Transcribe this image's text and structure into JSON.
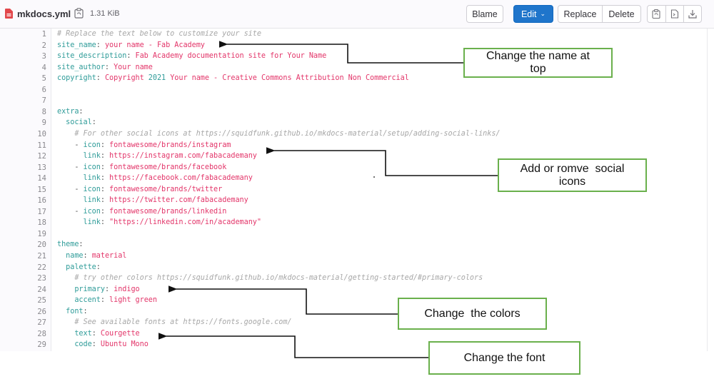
{
  "header": {
    "file_name": "mkdocs.yml",
    "file_size": "1.31 KiB",
    "buttons": {
      "blame": "Blame",
      "edit": "Edit",
      "replace": "Replace",
      "delete": "Delete"
    },
    "icons": [
      "file-icon",
      "copy-path-icon",
      "copy-contents-icon",
      "open-raw-icon",
      "download-icon"
    ]
  },
  "code": {
    "lines": [
      {
        "n": "1",
        "parts": [
          {
            "t": "c",
            "s": "# Replace the text below to customize your site"
          }
        ]
      },
      {
        "n": "2",
        "parts": [
          {
            "t": "k",
            "s": "site_name"
          },
          {
            "t": "p",
            "s": ": "
          },
          {
            "t": "v",
            "s": "your name - Fab Academy"
          }
        ]
      },
      {
        "n": "3",
        "parts": [
          {
            "t": "k",
            "s": "site_description"
          },
          {
            "t": "p",
            "s": ": "
          },
          {
            "t": "v",
            "s": "Fab Academy documentation site for Your Name"
          }
        ]
      },
      {
        "n": "4",
        "parts": [
          {
            "t": "k",
            "s": "site_author"
          },
          {
            "t": "p",
            "s": ": "
          },
          {
            "t": "v",
            "s": "Your name"
          }
        ]
      },
      {
        "n": "5",
        "parts": [
          {
            "t": "k",
            "s": "copyright"
          },
          {
            "t": "p",
            "s": ": "
          },
          {
            "t": "v",
            "s": "Copyright "
          },
          {
            "t": "k",
            "s": "2021"
          },
          {
            "t": "v",
            "s": " Your name - Creative Commons Attribution Non Commercial"
          }
        ]
      },
      {
        "n": "6",
        "parts": []
      },
      {
        "n": "7",
        "parts": []
      },
      {
        "n": "8",
        "parts": [
          {
            "t": "k",
            "s": "extra"
          },
          {
            "t": "p",
            "s": ":"
          }
        ]
      },
      {
        "n": "9",
        "parts": [
          {
            "t": "p",
            "s": "  "
          },
          {
            "t": "k",
            "s": "social"
          },
          {
            "t": "p",
            "s": ":"
          }
        ]
      },
      {
        "n": "10",
        "parts": [
          {
            "t": "c",
            "s": "    # For other social icons at https://squidfunk.github.io/mkdocs-material/setup/adding-social-links/"
          }
        ]
      },
      {
        "n": "11",
        "parts": [
          {
            "t": "p",
            "s": "    - "
          },
          {
            "t": "k",
            "s": "icon"
          },
          {
            "t": "p",
            "s": ": "
          },
          {
            "t": "v",
            "s": "fontawesome/brands/instagram"
          }
        ]
      },
      {
        "n": "12",
        "parts": [
          {
            "t": "p",
            "s": "      "
          },
          {
            "t": "k",
            "s": "link"
          },
          {
            "t": "p",
            "s": ": "
          },
          {
            "t": "v",
            "s": "https://instagram.com/fabacademany"
          }
        ]
      },
      {
        "n": "13",
        "parts": [
          {
            "t": "p",
            "s": "    - "
          },
          {
            "t": "k",
            "s": "icon"
          },
          {
            "t": "p",
            "s": ": "
          },
          {
            "t": "v",
            "s": "fontawesome/brands/facebook"
          }
        ]
      },
      {
        "n": "14",
        "parts": [
          {
            "t": "p",
            "s": "      "
          },
          {
            "t": "k",
            "s": "link"
          },
          {
            "t": "p",
            "s": ": "
          },
          {
            "t": "v",
            "s": "https://facebook.com/fabacademany"
          }
        ]
      },
      {
        "n": "15",
        "parts": [
          {
            "t": "p",
            "s": "    - "
          },
          {
            "t": "k",
            "s": "icon"
          },
          {
            "t": "p",
            "s": ": "
          },
          {
            "t": "v",
            "s": "fontawesome/brands/twitter"
          }
        ]
      },
      {
        "n": "16",
        "parts": [
          {
            "t": "p",
            "s": "      "
          },
          {
            "t": "k",
            "s": "link"
          },
          {
            "t": "p",
            "s": ": "
          },
          {
            "t": "v",
            "s": "https://twitter.com/fabacademany"
          }
        ]
      },
      {
        "n": "17",
        "parts": [
          {
            "t": "p",
            "s": "    - "
          },
          {
            "t": "k",
            "s": "icon"
          },
          {
            "t": "p",
            "s": ": "
          },
          {
            "t": "v",
            "s": "fontawesome/brands/linkedin"
          }
        ]
      },
      {
        "n": "18",
        "parts": [
          {
            "t": "p",
            "s": "      "
          },
          {
            "t": "k",
            "s": "link"
          },
          {
            "t": "p",
            "s": ": "
          },
          {
            "t": "v",
            "s": "\"https://linkedin.com/in/academany\""
          }
        ]
      },
      {
        "n": "19",
        "parts": []
      },
      {
        "n": "20",
        "parts": [
          {
            "t": "k",
            "s": "theme"
          },
          {
            "t": "p",
            "s": ":"
          }
        ]
      },
      {
        "n": "21",
        "parts": [
          {
            "t": "p",
            "s": "  "
          },
          {
            "t": "k",
            "s": "name"
          },
          {
            "t": "p",
            "s": ": "
          },
          {
            "t": "v",
            "s": "material"
          }
        ]
      },
      {
        "n": "22",
        "parts": [
          {
            "t": "p",
            "s": "  "
          },
          {
            "t": "k",
            "s": "palette"
          },
          {
            "t": "p",
            "s": ":"
          }
        ]
      },
      {
        "n": "23",
        "parts": [
          {
            "t": "c",
            "s": "    # try other colors https://squidfunk.github.io/mkdocs-material/getting-started/#primary-colors"
          }
        ]
      },
      {
        "n": "24",
        "parts": [
          {
            "t": "p",
            "s": "    "
          },
          {
            "t": "k",
            "s": "primary"
          },
          {
            "t": "p",
            "s": ": "
          },
          {
            "t": "v",
            "s": "indigo"
          }
        ]
      },
      {
        "n": "25",
        "parts": [
          {
            "t": "p",
            "s": "    "
          },
          {
            "t": "k",
            "s": "accent"
          },
          {
            "t": "p",
            "s": ": "
          },
          {
            "t": "v",
            "s": "light green"
          }
        ]
      },
      {
        "n": "26",
        "parts": [
          {
            "t": "p",
            "s": "  "
          },
          {
            "t": "k",
            "s": "font"
          },
          {
            "t": "p",
            "s": ":"
          }
        ]
      },
      {
        "n": "27",
        "parts": [
          {
            "t": "c",
            "s": "    # See available fonts at https://fonts.google.com/"
          }
        ]
      },
      {
        "n": "28",
        "parts": [
          {
            "t": "p",
            "s": "    "
          },
          {
            "t": "k",
            "s": "text"
          },
          {
            "t": "p",
            "s": ": "
          },
          {
            "t": "v",
            "s": "Courgette"
          }
        ]
      },
      {
        "n": "29",
        "parts": [
          {
            "t": "p",
            "s": "    "
          },
          {
            "t": "k",
            "s": "code"
          },
          {
            "t": "p",
            "s": ": "
          },
          {
            "t": "v",
            "s": "Ubuntu Mono"
          }
        ]
      }
    ]
  },
  "annotations": {
    "name_at_top": "Change the name at top",
    "social_icons": "Add or romve  social icons",
    "colors": "Change  the colors",
    "font": "Change the font"
  },
  "colors": {
    "key": "#2f9c99",
    "value": "#e3366a",
    "comment": "#a7a7a7",
    "edit_button": "#1f75cb",
    "annotation_border": "#6ab04c"
  }
}
